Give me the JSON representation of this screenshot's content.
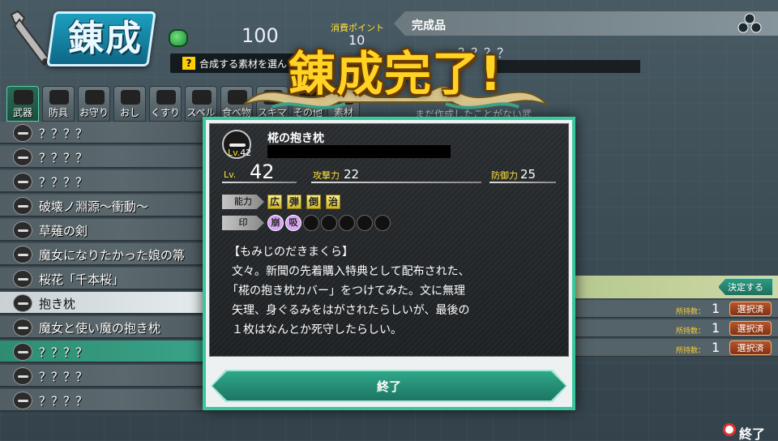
{
  "header": {
    "title": "錬成",
    "money": "100",
    "cost_label": "消費ポイント",
    "cost_value": "10",
    "hint_icon": "?",
    "hint": "合成する素材を選ん"
  },
  "result_panel": {
    "title": "完成品",
    "item_name": "？？？？",
    "qmark": "？",
    "desc": "まだ作成したことがない武"
  },
  "tabs": [
    {
      "label": "武器",
      "active": true
    },
    {
      "label": "防具"
    },
    {
      "label": "お守り"
    },
    {
      "label": "おし"
    },
    {
      "label": "くすり"
    },
    {
      "label": "スペル"
    },
    {
      "label": "食べ物"
    },
    {
      "label": "スキマ"
    },
    {
      "label": "その他"
    },
    {
      "label": "素材"
    }
  ],
  "list": [
    {
      "label": "？？？？"
    },
    {
      "label": "？？？？"
    },
    {
      "label": "？？？？"
    },
    {
      "label": "破壊ノ淵源〜衝動〜"
    },
    {
      "label": "草薙の剣"
    },
    {
      "label": "魔女になりたかった娘の箒"
    },
    {
      "label": "桜花「千本桜」"
    },
    {
      "label": "抱き枕",
      "selected": true
    },
    {
      "label": "魔女と使い魔の抱き枕"
    },
    {
      "label": "？？？？",
      "highlight": true
    },
    {
      "label": "？？？？"
    },
    {
      "label": "？？？？"
    }
  ],
  "materials": {
    "decide_label": "決定する",
    "have_label": "所持数：",
    "rows": [
      {
        "count": "1",
        "button": "選択済"
      },
      {
        "count": "1",
        "button": "選択済"
      },
      {
        "count": "1",
        "button": "選択済"
      }
    ]
  },
  "footer": {
    "end_label": "終了"
  },
  "banner": {
    "text": "錬成完了!"
  },
  "dialog": {
    "item_name": "椛の抱き枕",
    "lv_small_label": "Lv.",
    "lv_small_value": "42",
    "lv_label": "Lv.",
    "lv_value": "42",
    "atk_label": "攻撃力",
    "atk_value": "22",
    "def_label": "防御力",
    "def_value": "25",
    "ability_label": "能力",
    "abilities": [
      "広",
      "弾",
      "倒",
      "治"
    ],
    "seal_label": "印",
    "seals": [
      "崩",
      "吸",
      "",
      "",
      "",
      "",
      ""
    ],
    "desc_title": "【もみじのだきまくら】",
    "desc_lines": [
      "文々。新聞の先着購入特典として配布された、",
      "「椛の抱き枕カバー」をつけてみた。文に無理",
      "矢理、身ぐるみをはがされたらしいが、最後の",
      "１枚はなんとか死守したらしい。"
    ],
    "close_label": "終了"
  },
  "colors": {
    "accent": "#39c79d",
    "banner": "#ffd324",
    "stat_label": "#ffe13b"
  }
}
